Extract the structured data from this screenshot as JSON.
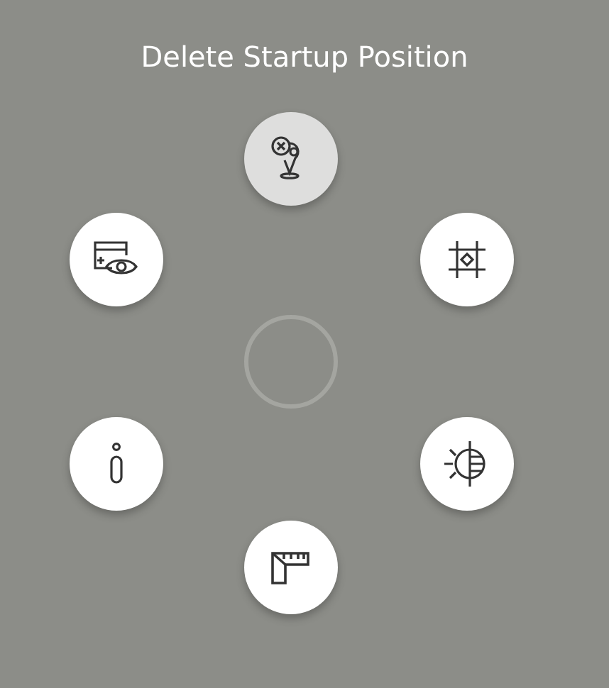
{
  "title": "Delete Startup Position",
  "buttons": [
    {
      "kind": "delete-position",
      "selected": true
    },
    {
      "kind": "view-card",
      "selected": false
    },
    {
      "kind": "frame",
      "selected": false
    },
    {
      "kind": "info",
      "selected": false
    },
    {
      "kind": "exposure",
      "selected": false
    },
    {
      "kind": "ruler",
      "selected": false
    }
  ]
}
